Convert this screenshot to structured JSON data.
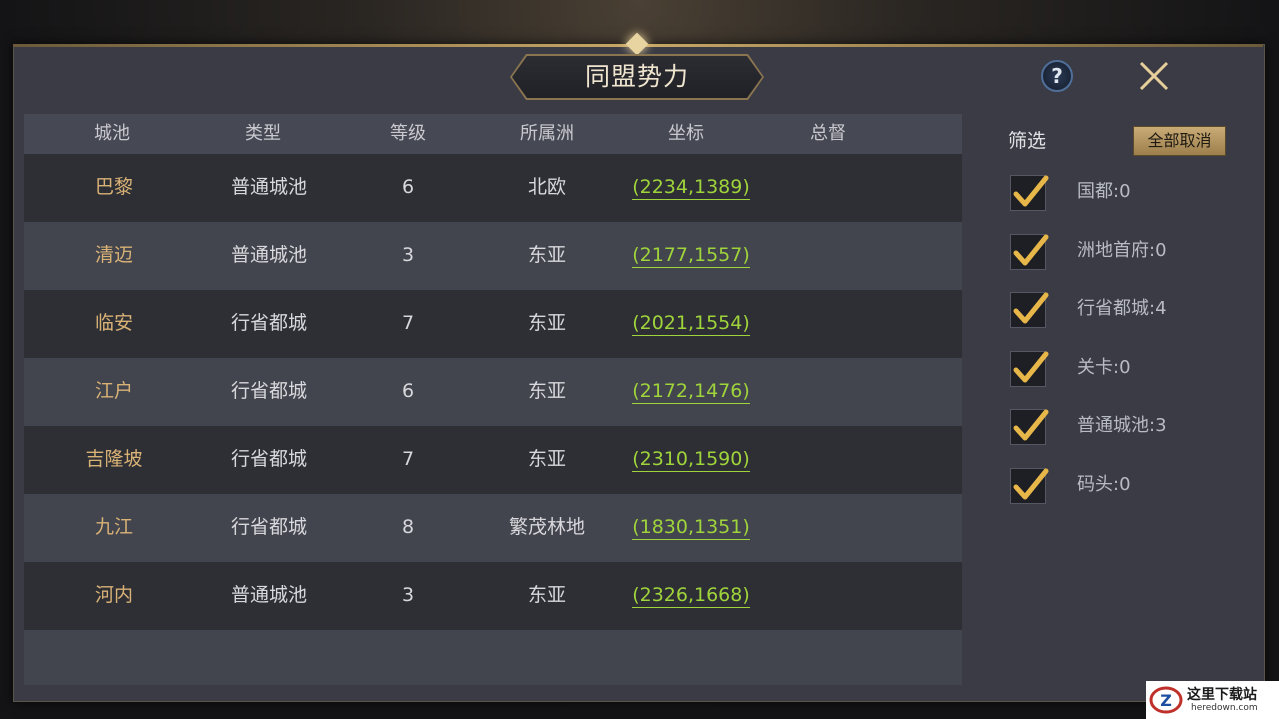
{
  "title": "同盟势力",
  "help_label": "?",
  "table": {
    "headers": [
      "城池",
      "类型",
      "等级",
      "所属洲",
      "坐标",
      "总督"
    ],
    "rows": [
      {
        "city": "巴黎",
        "type": "普通城池",
        "level": "6",
        "continent": "北欧",
        "coord": "(2234,1389)",
        "governor": ""
      },
      {
        "city": "清迈",
        "type": "普通城池",
        "level": "3",
        "continent": "东亚",
        "coord": "(2177,1557)",
        "governor": ""
      },
      {
        "city": "临安",
        "type": "行省都城",
        "level": "7",
        "continent": "东亚",
        "coord": "(2021,1554)",
        "governor": ""
      },
      {
        "city": "江户",
        "type": "行省都城",
        "level": "6",
        "continent": "东亚",
        "coord": "(2172,1476)",
        "governor": ""
      },
      {
        "city": "吉隆坡",
        "type": "行省都城",
        "level": "7",
        "continent": "东亚",
        "coord": "(2310,1590)",
        "governor": ""
      },
      {
        "city": "九江",
        "type": "行省都城",
        "level": "8",
        "continent": "繁茂林地",
        "coord": "(1830,1351)",
        "governor": ""
      },
      {
        "city": "河内",
        "type": "普通城池",
        "level": "3",
        "continent": "东亚",
        "coord": "(2326,1668)",
        "governor": ""
      }
    ]
  },
  "filter": {
    "label": "筛选",
    "cancel_all": "全部取消",
    "options": [
      {
        "label": "国都:0",
        "checked": true
      },
      {
        "label": "洲地首府:0",
        "checked": true
      },
      {
        "label": "行省都城:4",
        "checked": true
      },
      {
        "label": "关卡:0",
        "checked": true
      },
      {
        "label": "普通城池:3",
        "checked": true
      },
      {
        "label": "码头:0",
        "checked": true
      }
    ]
  },
  "watermark": {
    "text": "这里下载站",
    "sub": "heredown.com"
  },
  "colors": {
    "city_name": "#d9b276",
    "coord_link": "#9fd43a",
    "check_mark": "#e8b74a"
  }
}
